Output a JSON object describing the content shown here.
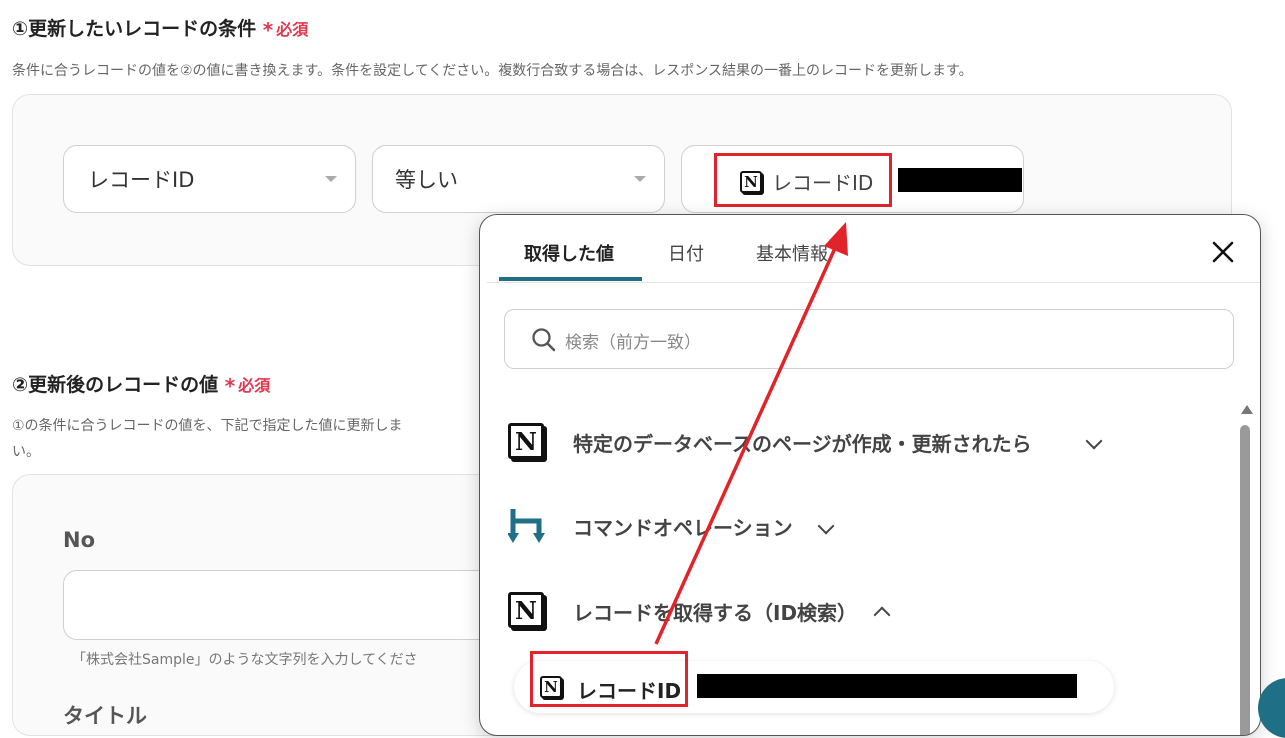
{
  "section1": {
    "title": "①更新したいレコードの条件",
    "required": "必須",
    "description": "条件に合うレコードの値を②の値に書き換えます。条件を設定してください。複数行合致する場合は、レスポンス結果の一番上のレコードを更新します。",
    "field_select": "レコードID",
    "operator_select": "等しい",
    "value_chip_label": "レコードID"
  },
  "section2": {
    "title": "②更新後のレコードの値",
    "required": "必須",
    "description_line1": "①の条件に合うレコードの値を、下記で指定した値に更新しま",
    "description_line2": "い。",
    "fields": [
      {
        "label": "No",
        "value": "",
        "hint": "「株式会社Sample」のような文字列を入力してくださ"
      },
      {
        "label": "タイトル"
      }
    ]
  },
  "popup": {
    "tabs": [
      "取得した値",
      "日付",
      "基本情報"
    ],
    "active_tab": 0,
    "search_placeholder": "検索（前方一致）",
    "groups": [
      {
        "title": "特定のデータベースのページが作成・更新されたら",
        "icon": "notion-icon",
        "expanded": false
      },
      {
        "title": "コマンドオペレーション",
        "icon": "command-operation-icon",
        "expanded": false
      },
      {
        "title": "レコードを取得する（ID検索）",
        "icon": "notion-icon",
        "expanded": true
      }
    ],
    "selected_item_label": "レコードID"
  },
  "colors": {
    "required": "#e0394f",
    "annotation_red": "#e0242a",
    "tab_indicator": "#1f6f86",
    "command_icon": "#1f6f86"
  }
}
